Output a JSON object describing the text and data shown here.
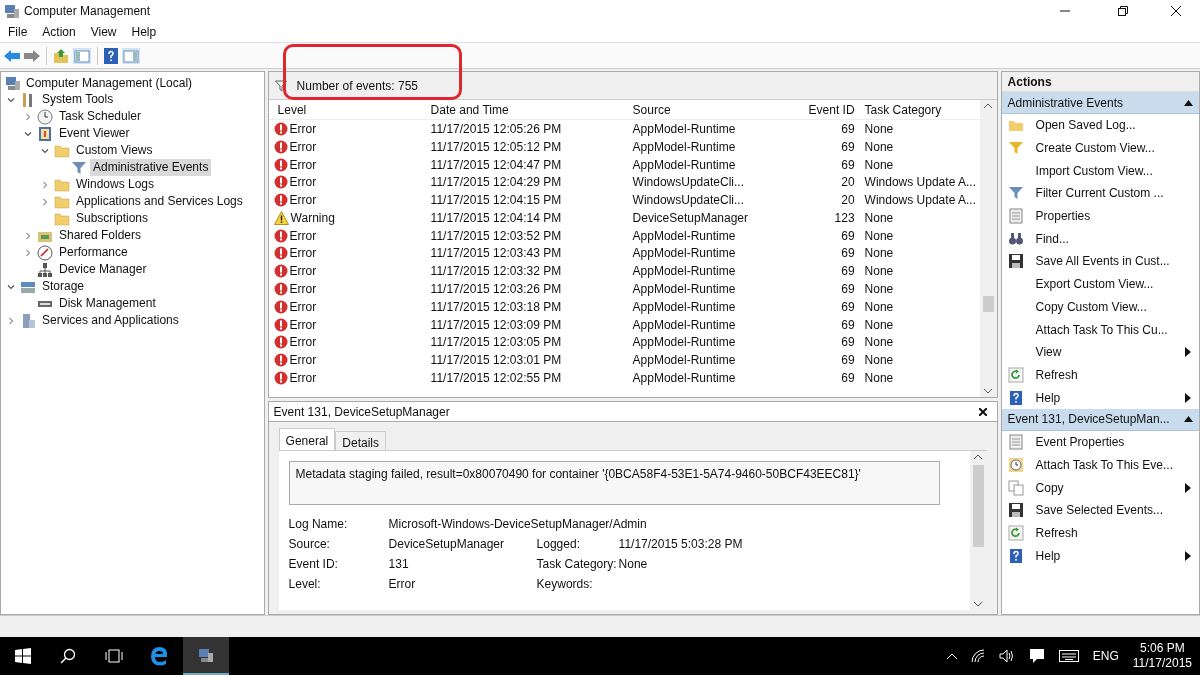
{
  "window": {
    "title": "Computer Management"
  },
  "menu": [
    "File",
    "Action",
    "View",
    "Help"
  ],
  "tree": [
    {
      "label": "Computer Management (Local)",
      "kind": "computer",
      "selected": false,
      "children": [
        {
          "label": "System Tools",
          "kind": "tools",
          "expandable": true,
          "expanded": true,
          "selected": false,
          "children": [
            {
              "label": "Task Scheduler",
              "kind": "clock",
              "expandable": true,
              "expanded": false,
              "selected": false
            },
            {
              "label": "Event Viewer",
              "kind": "viewer",
              "expandable": true,
              "expanded": true,
              "selected": false,
              "children": [
                {
                  "label": "Custom Views",
                  "kind": "folder",
                  "expandable": true,
                  "expanded": true,
                  "selected": false,
                  "children": [
                    {
                      "label": "Administrative Events",
                      "kind": "filter",
                      "expandable": false,
                      "selected": true
                    }
                  ]
                },
                {
                  "label": "Windows Logs",
                  "kind": "folder",
                  "expandable": true,
                  "expanded": false,
                  "selected": false
                },
                {
                  "label": "Applications and Services Logs",
                  "kind": "folder",
                  "expandable": true,
                  "expanded": false,
                  "selected": false
                },
                {
                  "label": "Subscriptions",
                  "kind": "folder",
                  "expandable": false,
                  "selected": false
                }
              ]
            },
            {
              "label": "Shared Folders",
              "kind": "share",
              "expandable": true,
              "expanded": false,
              "selected": false
            },
            {
              "label": "Performance",
              "kind": "performance",
              "expandable": true,
              "expanded": false,
              "selected": false
            },
            {
              "label": "Device Manager",
              "kind": "device",
              "expandable": false,
              "selected": false
            }
          ]
        },
        {
          "label": "Storage",
          "kind": "storage",
          "expandable": true,
          "expanded": true,
          "selected": false,
          "children": [
            {
              "label": "Disk Management",
              "kind": "disk",
              "expandable": false,
              "selected": false
            }
          ]
        },
        {
          "label": "Services and Applications",
          "kind": "services",
          "expandable": true,
          "expanded": false,
          "selected": false
        }
      ]
    }
  ],
  "events": {
    "count_label": "Number of events: 755",
    "columns": [
      "Level",
      "Date and Time",
      "Source",
      "Event ID",
      "Task Category"
    ],
    "rows": [
      {
        "kind": "error",
        "level": "Error",
        "date": "11/17/2015 12:05:26 PM",
        "source": "AppModel-Runtime",
        "event_id": "69",
        "category": "None"
      },
      {
        "kind": "error",
        "level": "Error",
        "date": "11/17/2015 12:05:12 PM",
        "source": "AppModel-Runtime",
        "event_id": "69",
        "category": "None"
      },
      {
        "kind": "error",
        "level": "Error",
        "date": "11/17/2015 12:04:47 PM",
        "source": "AppModel-Runtime",
        "event_id": "69",
        "category": "None"
      },
      {
        "kind": "error",
        "level": "Error",
        "date": "11/17/2015 12:04:29 PM",
        "source": "WindowsUpdateCli...",
        "event_id": "20",
        "category": "Windows Update A..."
      },
      {
        "kind": "error",
        "level": "Error",
        "date": "11/17/2015 12:04:15 PM",
        "source": "WindowsUpdateCli...",
        "event_id": "20",
        "category": "Windows Update A..."
      },
      {
        "kind": "warning",
        "level": "Warning",
        "date": "11/17/2015 12:04:14 PM",
        "source": "DeviceSetupManager",
        "event_id": "123",
        "category": "None"
      },
      {
        "kind": "error",
        "level": "Error",
        "date": "11/17/2015 12:03:52 PM",
        "source": "AppModel-Runtime",
        "event_id": "69",
        "category": "None"
      },
      {
        "kind": "error",
        "level": "Error",
        "date": "11/17/2015 12:03:43 PM",
        "source": "AppModel-Runtime",
        "event_id": "69",
        "category": "None"
      },
      {
        "kind": "error",
        "level": "Error",
        "date": "11/17/2015 12:03:32 PM",
        "source": "AppModel-Runtime",
        "event_id": "69",
        "category": "None"
      },
      {
        "kind": "error",
        "level": "Error",
        "date": "11/17/2015 12:03:26 PM",
        "source": "AppModel-Runtime",
        "event_id": "69",
        "category": "None"
      },
      {
        "kind": "error",
        "level": "Error",
        "date": "11/17/2015 12:03:18 PM",
        "source": "AppModel-Runtime",
        "event_id": "69",
        "category": "None"
      },
      {
        "kind": "error",
        "level": "Error",
        "date": "11/17/2015 12:03:09 PM",
        "source": "AppModel-Runtime",
        "event_id": "69",
        "category": "None"
      },
      {
        "kind": "error",
        "level": "Error",
        "date": "11/17/2015 12:03:05 PM",
        "source": "AppModel-Runtime",
        "event_id": "69",
        "category": "None"
      },
      {
        "kind": "error",
        "level": "Error",
        "date": "11/17/2015 12:03:01 PM",
        "source": "AppModel-Runtime",
        "event_id": "69",
        "category": "None"
      },
      {
        "kind": "error",
        "level": "Error",
        "date": "11/17/2015 12:02:55 PM",
        "source": "AppModel-Runtime",
        "event_id": "69",
        "category": "None"
      }
    ]
  },
  "detail": {
    "title": "Event 131, DeviceSetupManager",
    "tabs": [
      {
        "label": "General",
        "selected": true
      },
      {
        "label": "Details",
        "selected": false
      }
    ],
    "message": "Metadata staging failed, result=0x80070490 for container '{0BCA58F4-53E1-5A74-9460-50BCF43EEC81}'",
    "fields": [
      [
        {
          "label": "Log Name:",
          "value": "Microsoft-Windows-DeviceSetupManager/Admin"
        }
      ],
      [
        {
          "label": "Source:",
          "value": "DeviceSetupManager"
        },
        {
          "label": "Logged:",
          "value": "11/17/2015 5:03:28 PM"
        }
      ],
      [
        {
          "label": "Event ID:",
          "value": "131"
        },
        {
          "label": "Task Category:",
          "value": "None"
        }
      ],
      [
        {
          "label": "Level:",
          "value": "Error"
        },
        {
          "label": "Keywords:"
        }
      ]
    ]
  },
  "actions": {
    "title": "Actions",
    "sections": [
      {
        "title": "Administrative Events",
        "items": [
          {
            "label": "Open Saved Log...",
            "kind": "open",
            "submenu": false
          },
          {
            "label": "Create Custom View...",
            "kind": "create-filter",
            "submenu": false
          },
          {
            "label": "Import Custom View...",
            "kind": "none",
            "submenu": false
          },
          {
            "label": "Filter Current Custom ...",
            "kind": "filter",
            "submenu": false
          },
          {
            "label": "Properties",
            "kind": "properties",
            "submenu": false
          },
          {
            "label": "Find...",
            "kind": "find",
            "submenu": false
          },
          {
            "label": "Save All Events in Cust...",
            "kind": "save",
            "submenu": false
          },
          {
            "label": "Export Custom View...",
            "kind": "none",
            "submenu": false
          },
          {
            "label": "Copy Custom View...",
            "kind": "none",
            "submenu": false
          },
          {
            "label": "Attach Task To This Cu...",
            "kind": "none",
            "submenu": false
          },
          {
            "label": "View",
            "kind": "none",
            "submenu": true
          },
          {
            "label": "Refresh",
            "kind": "refresh",
            "submenu": false
          },
          {
            "label": "Help",
            "kind": "help",
            "submenu": true
          }
        ]
      },
      {
        "title": "Event 131, DeviceSetupMan...",
        "items": [
          {
            "label": "Event Properties",
            "kind": "properties",
            "submenu": false
          },
          {
            "label": "Attach Task To This Eve...",
            "kind": "task",
            "submenu": false
          },
          {
            "label": "Copy",
            "kind": "copy",
            "submenu": true
          },
          {
            "label": "Save Selected Events...",
            "kind": "save",
            "submenu": false
          },
          {
            "label": "Refresh",
            "kind": "refresh",
            "submenu": false
          },
          {
            "label": "Help",
            "kind": "help",
            "submenu": true
          }
        ]
      }
    ]
  },
  "taskbar": {
    "language": "ENG",
    "time": "5:06 PM",
    "date": "11/17/2015"
  }
}
